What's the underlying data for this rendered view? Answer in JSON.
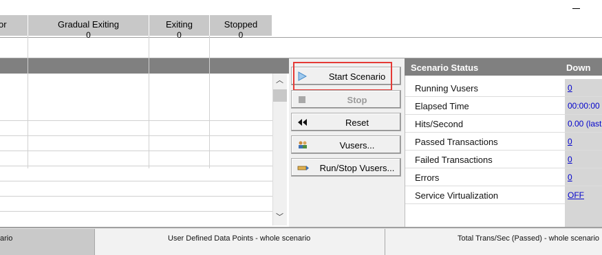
{
  "groups_table": {
    "columns": [
      {
        "title": "or",
        "value": ""
      },
      {
        "title": "Gradual Exiting",
        "value": "0"
      },
      {
        "title": "Exiting",
        "value": "0"
      },
      {
        "title": "Stopped",
        "value": "0"
      }
    ]
  },
  "scroll": {
    "up": "︿",
    "down": "﹀"
  },
  "buttons": {
    "start": {
      "label": "Start Scenario",
      "icon": "play-icon"
    },
    "stop": {
      "label": "Stop",
      "icon": "stop-icon"
    },
    "reset": {
      "label": "Reset",
      "icon": "rewind-icon"
    },
    "vusers": {
      "label": "Vusers...",
      "icon": "users-icon"
    },
    "run_stop": {
      "label": "Run/Stop Vusers...",
      "icon": "run-stop-icon"
    }
  },
  "scenario_status": {
    "title": "Scenario Status",
    "state": "Down",
    "rows": [
      {
        "label": "Running Vusers",
        "value": "0"
      },
      {
        "label": "Elapsed Time",
        "value": "00:00:00"
      },
      {
        "label": "Hits/Second",
        "value": "0.00 (last"
      },
      {
        "label": "Passed Transactions",
        "value": "0"
      },
      {
        "label": "Failed Transactions",
        "value": "0"
      },
      {
        "label": "Errors",
        "value": "0"
      },
      {
        "label": "Service Virtualization",
        "value": "OFF"
      }
    ]
  },
  "graph_tabs": [
    {
      "label": "ario"
    },
    {
      "label": "User Defined Data Points - whole scenario"
    },
    {
      "label": "Total Trans/Sec (Passed) - whole scenario"
    }
  ],
  "colors": {
    "highlight": "#e53935",
    "link": "#0000cc",
    "header_bg": "#808080"
  }
}
